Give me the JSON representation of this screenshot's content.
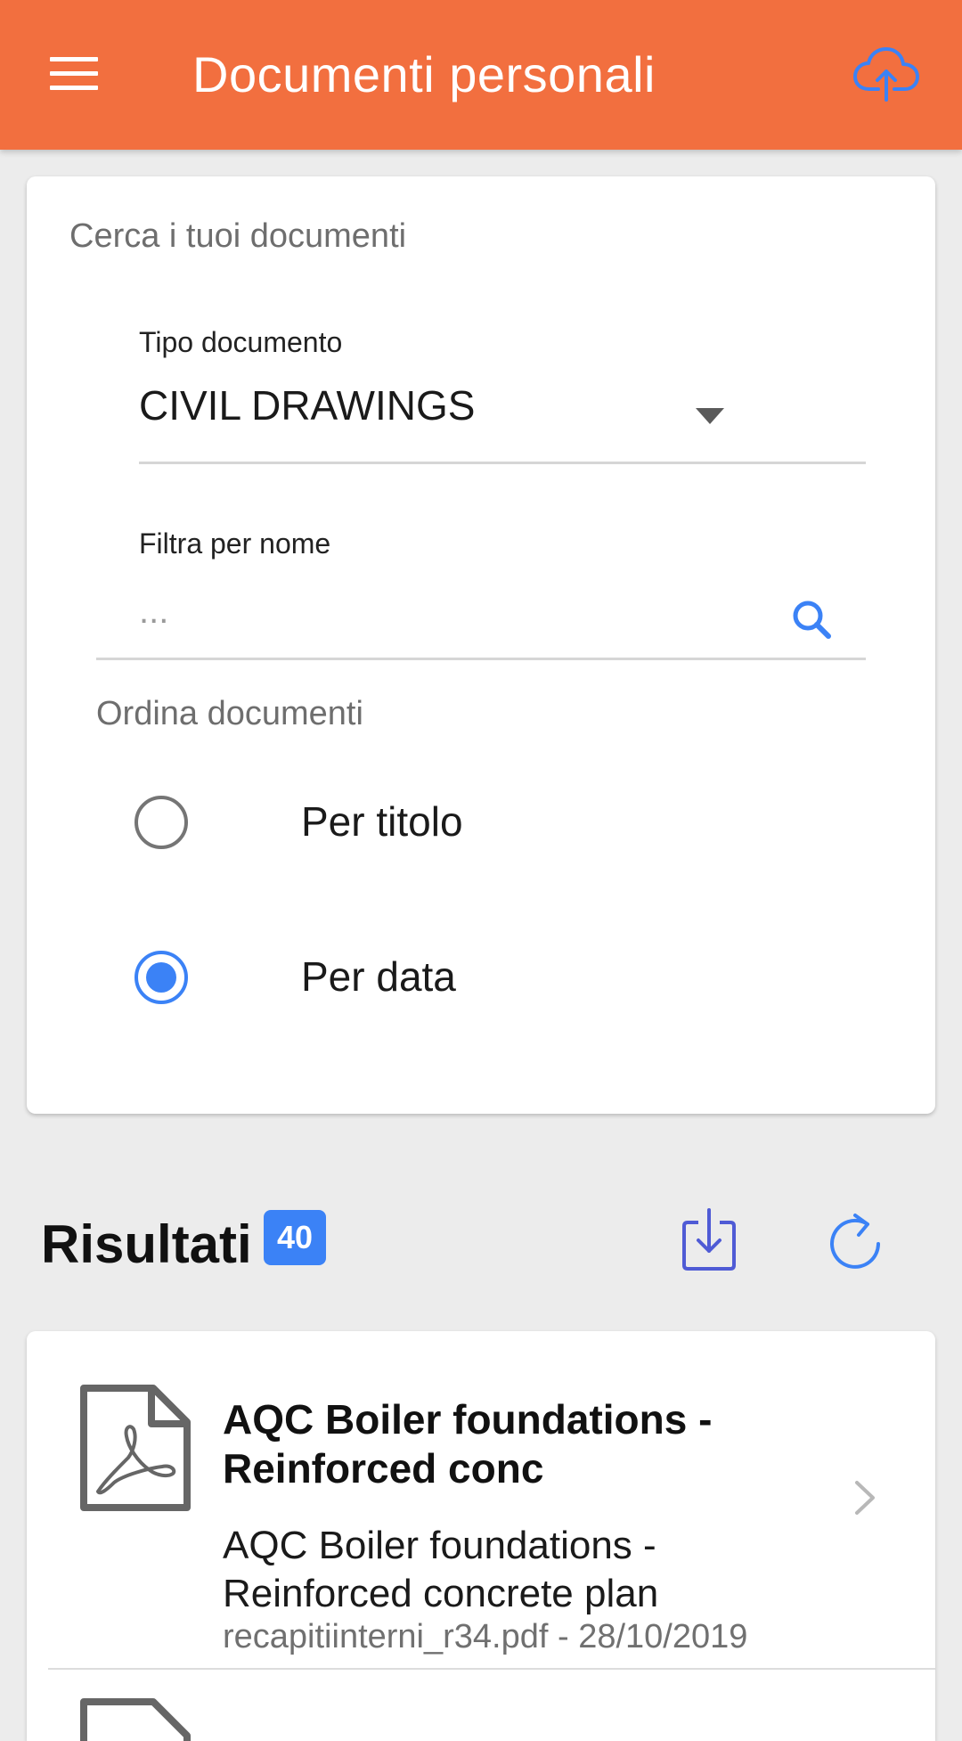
{
  "app_bar": {
    "title": "Documenti personali",
    "menu_icon": "hamburger-menu-icon",
    "upload_icon": "cloud-upload-icon",
    "background_color": "#f26f3f"
  },
  "search": {
    "heading": "Cerca i tuoi documenti",
    "doc_type": {
      "label": "Tipo documento",
      "value": "CIVIL DRAWINGS"
    },
    "name_filter": {
      "label": "Filtra per nome",
      "placeholder": "...",
      "value": ""
    },
    "sort": {
      "heading": "Ordina documenti",
      "options": [
        {
          "label": "Per titolo",
          "selected": false
        },
        {
          "label": "Per data",
          "selected": true
        }
      ]
    }
  },
  "results": {
    "title": "Risultati",
    "count": "40",
    "download_icon": "download-icon",
    "refresh_icon": "refresh-icon",
    "items": [
      {
        "title": "AQC Boiler foundations - Reinforced conc",
        "description": "AQC Boiler foundations - Reinforced concrete plan",
        "meta": "recapitiinterni_r34.pdf - 28/10/2019",
        "icon": "pdf-file-icon"
      }
    ]
  },
  "colors": {
    "accent_blue": "#3b82f6",
    "radio_unselected": "#757575"
  }
}
